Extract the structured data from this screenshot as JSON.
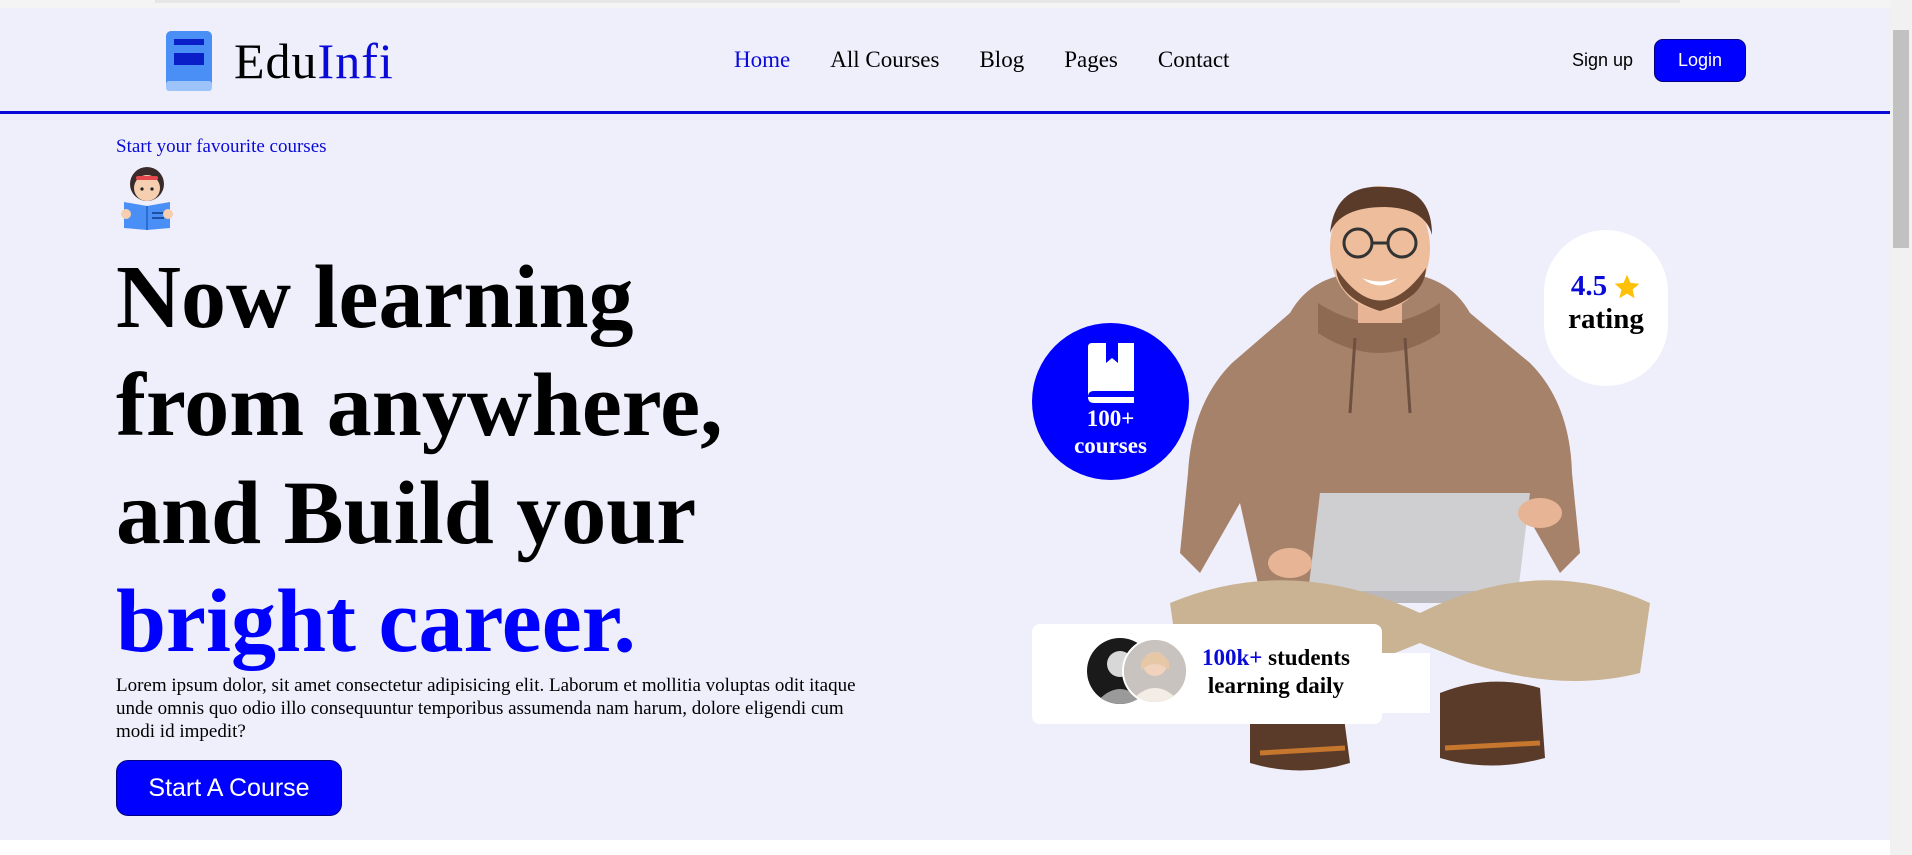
{
  "brand": {
    "name_part1": "Edu",
    "name_part2": "Infi",
    "accent_color": "#0a0ad8",
    "icon": "book-icon"
  },
  "nav": {
    "items": [
      {
        "label": "Home",
        "active": true
      },
      {
        "label": "All Courses",
        "active": false
      },
      {
        "label": "Blog",
        "active": false
      },
      {
        "label": "Pages",
        "active": false
      },
      {
        "label": "Contact",
        "active": false
      }
    ]
  },
  "auth": {
    "signup_label": "Sign up",
    "login_label": "Login"
  },
  "hero": {
    "eyebrow": "Start your favourite courses",
    "reader_icon": "reading-girl-icon",
    "headline_lines": [
      "Now learning",
      "from anywhere,",
      "and Build your"
    ],
    "headline_highlight": "bright career.",
    "description": "Lorem ipsum dolor, sit amet consectetur adipisicing elit. Laborum et mollitia voluptas odit itaque unde omnis quo odio illo consequuntur temporibus assumenda nam harum, dolore eligendi cum modi id impedit?",
    "cta_label": "Start A Course"
  },
  "stats": {
    "courses": {
      "count": "100+",
      "label": "courses",
      "icon": "book-icon"
    },
    "rating": {
      "value": "4.5",
      "label": "rating",
      "icon": "star-icon",
      "star_color": "#ffc107"
    },
    "students": {
      "count": "100k+",
      "label1": "students",
      "label2": "learning daily"
    }
  },
  "colors": {
    "primary": "#0000ff",
    "background": "#efeffc"
  }
}
